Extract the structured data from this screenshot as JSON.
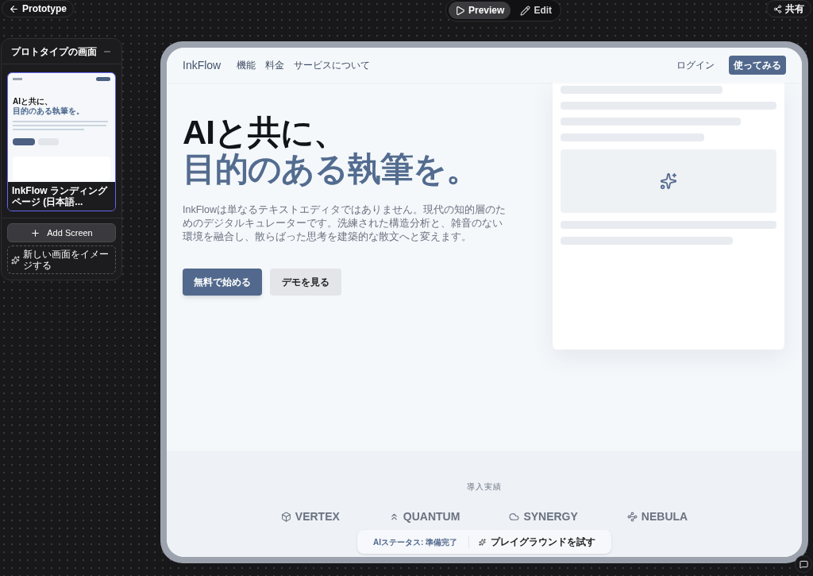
{
  "topbar": {
    "back": "Prototype",
    "modes": [
      {
        "label": "Preview",
        "kind": "preview",
        "selected": true
      },
      {
        "label": "Edit",
        "kind": "edit",
        "selected": false
      }
    ],
    "share": "共有"
  },
  "sidebar": {
    "title": "プロトタイプの画面",
    "screens": [
      {
        "name": "InkFlow ランディングページ (日本語...",
        "selected": true,
        "thumbnail": {
          "heading": "AIと共に、",
          "accent": "目的のある執筆を。"
        }
      }
    ],
    "add_button": "Add Screen",
    "imagine_button": "新しい画面をイメージする"
  },
  "page": {
    "brand": "InkFlow",
    "nav": [
      "機能",
      "料金",
      "サービスについて"
    ],
    "login": "ログイン",
    "cta": "使ってみる",
    "hero": {
      "heading": "AIと共に、",
      "accent": "目的のある執筆を。",
      "body": "InkFlowは単なるテキストエディタではありません。現代の知的層のためのデジタルキュレーターです。洗練された構造分析と、雑音のない環境を融合し、散らばった思考を建築的な散文へと変えます。",
      "buttons": [
        {
          "label": "無料で始める",
          "kind": "primary"
        },
        {
          "label": "デモを見る",
          "kind": "secondary"
        }
      ]
    },
    "clients": {
      "title": "導入実績",
      "logos": [
        {
          "name": "VERTEX",
          "kind": "cube"
        },
        {
          "name": "QUANTUM",
          "kind": "chevrons"
        },
        {
          "name": "SYNERGY",
          "kind": "dome"
        },
        {
          "name": "NEBULA",
          "kind": "nodes"
        }
      ]
    },
    "status": {
      "label": "AIステータス: 準備完了",
      "action": "プレイグラウンドを試す"
    }
  }
}
